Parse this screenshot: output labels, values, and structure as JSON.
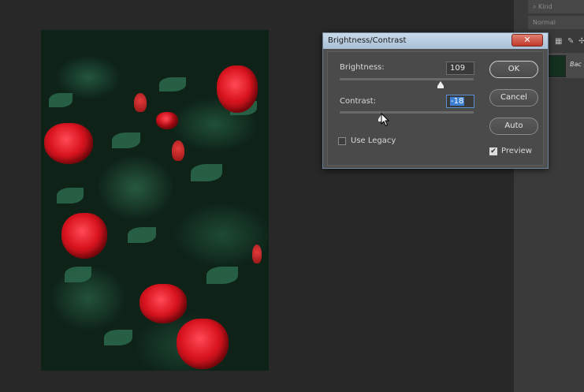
{
  "layers_panel": {
    "kind_filter": "Kind",
    "blend_mode": "Normal",
    "layer_name": "Bac"
  },
  "dialog": {
    "title": "Brightness/Contrast",
    "close_glyph": "✕",
    "brightness": {
      "label": "Brightness:",
      "value": "109",
      "level": 0.75
    },
    "contrast": {
      "label": "Contrast:",
      "value": "-18",
      "level": 0.31
    },
    "use_legacy": {
      "label": "Use Legacy",
      "checked": false
    },
    "preview": {
      "label": "Preview",
      "checked": true
    },
    "buttons": {
      "ok": "OK",
      "cancel": "Cancel",
      "auto": "Auto"
    }
  }
}
